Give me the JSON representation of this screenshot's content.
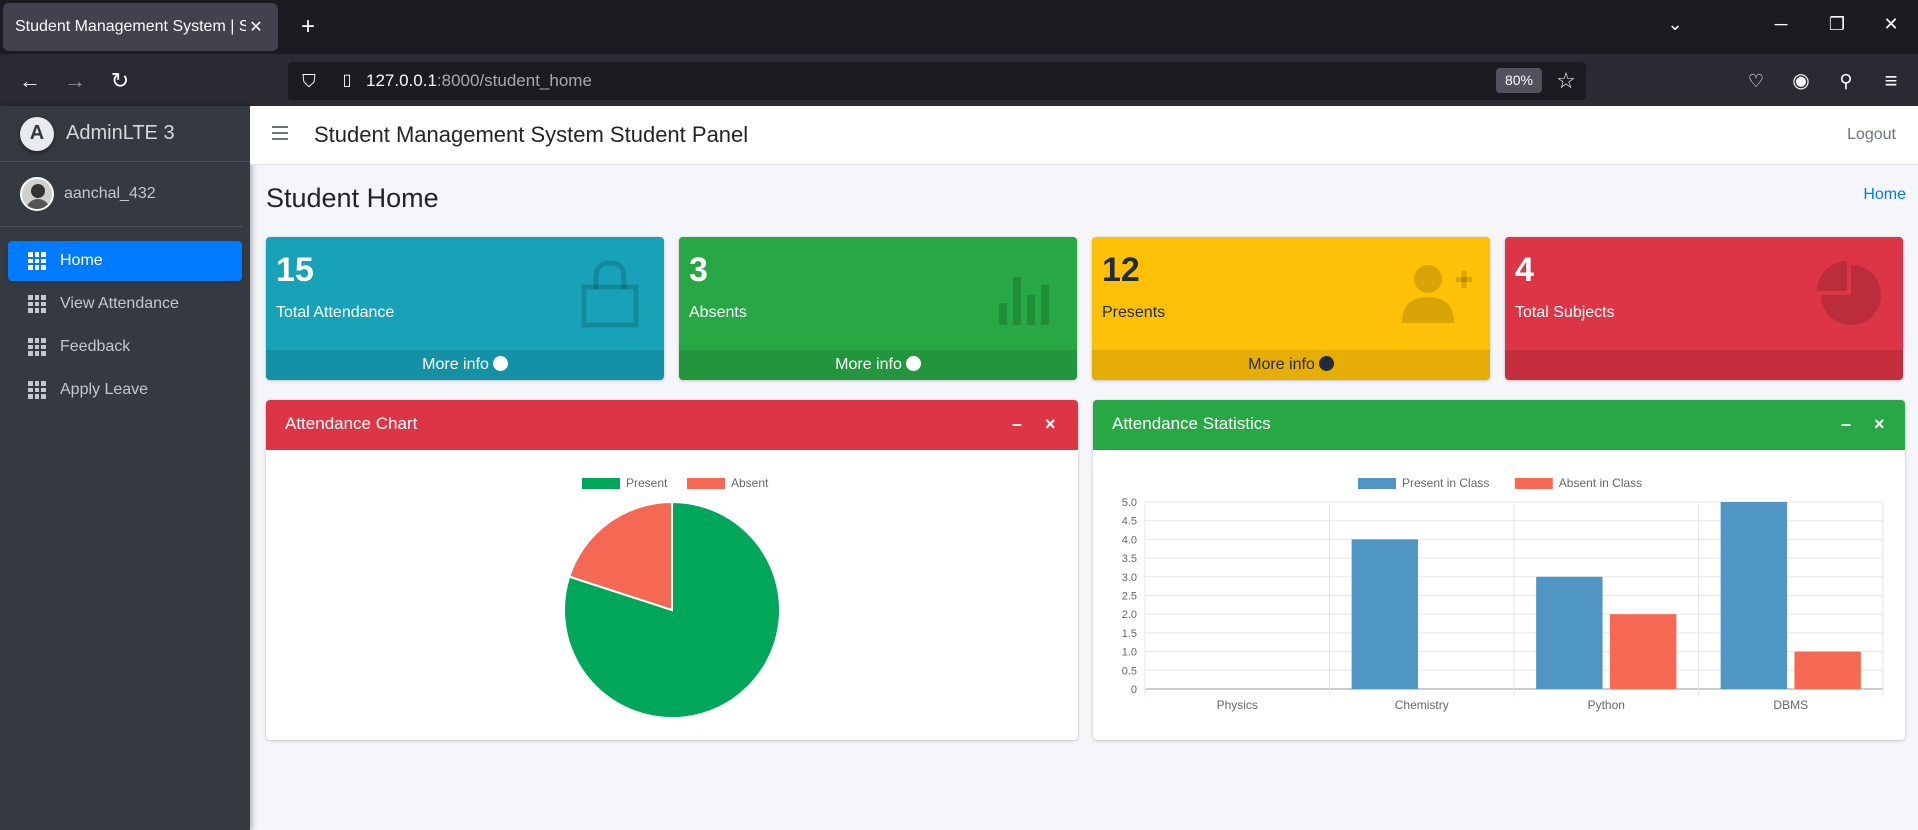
{
  "browser": {
    "tab_title": "Student Management System | Stud",
    "tab_close": "✕",
    "new_tab": "+",
    "url_host": "127.0.0.1",
    "url_rest": ":8000/student_home",
    "zoom": "80%"
  },
  "sidebar": {
    "brand": "AdminLTE 3",
    "brand_logo": "A",
    "user": "aanchal_432",
    "items": [
      {
        "label": "Home",
        "active": true
      },
      {
        "label": "View Attendance",
        "active": false
      },
      {
        "label": "Feedback",
        "active": false
      },
      {
        "label": "Apply Leave",
        "active": false
      }
    ]
  },
  "header": {
    "title": "Student Management System Student Panel",
    "logout": "Logout"
  },
  "page": {
    "title": "Student Home",
    "breadcrumb": "Home"
  },
  "boxes": [
    {
      "value": "15",
      "label": "Total Attendance",
      "footer": "More info",
      "color": "#17a2b8",
      "icon": "shopping-bag-icon"
    },
    {
      "value": "3",
      "label": "Absents",
      "footer": "More info",
      "color": "#28a745",
      "icon": "bar-chart-icon"
    },
    {
      "value": "12",
      "label": "Presents",
      "footer": "More info",
      "color": "#ffc107",
      "icon": "user-plus-icon"
    },
    {
      "value": "4",
      "label": "Total Subjects",
      "footer": "",
      "color": "#dc3545",
      "icon": "pie-chart-icon"
    }
  ],
  "cards": {
    "attendance_chart": {
      "title": "Attendance Chart",
      "minimize": "–",
      "close": "×"
    },
    "attendance_stats": {
      "title": "Attendance Statistics",
      "minimize": "–",
      "close": "×"
    }
  },
  "chart_data": [
    {
      "type": "pie",
      "labels": [
        "Present",
        "Absent"
      ],
      "values": [
        12,
        3
      ],
      "colors": [
        "#00a65a",
        "#f56954"
      ],
      "legend": "top"
    },
    {
      "type": "bar",
      "categories": [
        "Physics",
        "Chemistry",
        "Python",
        "DBMS"
      ],
      "series": [
        {
          "name": "Present in Class",
          "values": [
            0,
            4,
            3,
            5
          ],
          "color": "#4f96c5"
        },
        {
          "name": "Absent in Class",
          "values": [
            0,
            0,
            2,
            1
          ],
          "color": "#f56954"
        }
      ],
      "ylim": [
        0,
        5
      ],
      "yticks": [
        "0",
        "0.5",
        "1.0",
        "1.5",
        "2.0",
        "2.5",
        "3.0",
        "3.5",
        "4.0",
        "4.5",
        "5.0"
      ],
      "grid": true,
      "legend": "top"
    }
  ]
}
